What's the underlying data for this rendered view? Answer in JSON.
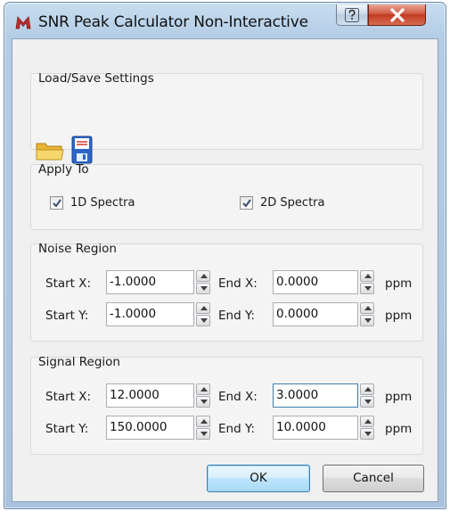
{
  "window": {
    "title": "SNR Peak Calculator Non-Interactive",
    "icons": {
      "app": "app-logo-icon",
      "help": "question-mark-icon",
      "close": "close-x-icon"
    }
  },
  "load_save": {
    "title": "Load/Save Settings",
    "load_icon": "folder-open-icon",
    "save_icon": "floppy-disk-icon"
  },
  "apply_to": {
    "title": "Apply To",
    "spectra_1d": {
      "label": "1D Spectra",
      "checked": true
    },
    "spectra_2d": {
      "label": "2D Spectra",
      "checked": true
    }
  },
  "noise_region": {
    "title": "Noise Region",
    "start_x_label": "Start X:",
    "start_x": "-1.0000",
    "end_x_label": "End X:",
    "end_x": "0.0000",
    "start_y_label": "Start Y:",
    "start_y": "-1.0000",
    "end_y_label": "End Y:",
    "end_y": "0.0000",
    "unit": "ppm"
  },
  "signal_region": {
    "title": "Signal Region",
    "start_x_label": "Start X:",
    "start_x": "12.0000",
    "end_x_label": "End X:",
    "end_x": "3.0000",
    "start_y_label": "Start Y:",
    "start_y": "150.0000",
    "end_y_label": "End Y:",
    "end_y": "10.0000",
    "unit": "ppm"
  },
  "buttons": {
    "ok": "OK",
    "cancel": "Cancel"
  },
  "colors": {
    "close_button": "#c23a22",
    "focus_border": "#3c7fb1",
    "titlebar": "#b3cde6"
  }
}
